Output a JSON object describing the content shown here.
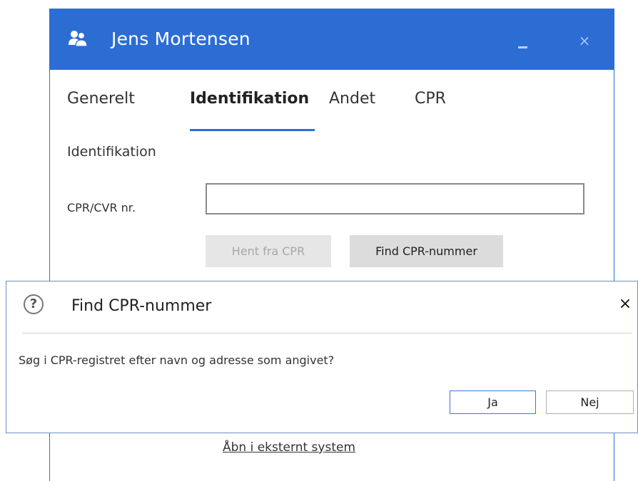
{
  "window": {
    "title": "Jens Mortensen",
    "icon": "people-icon",
    "close_glyph": "×"
  },
  "tabs": [
    {
      "label": "Generelt",
      "active": false
    },
    {
      "label": "Identifikation",
      "active": true
    },
    {
      "label": "Andet",
      "active": false
    },
    {
      "label": "CPR",
      "active": false
    }
  ],
  "form": {
    "section_title": "Identifikation",
    "cpr_label": "CPR/CVR nr.",
    "cpr_value": "",
    "hent_button": "Hent fra CPR",
    "find_button": "Find CPR-nummer",
    "external_link": "Åbn i eksternt system"
  },
  "dialog": {
    "title": "Find CPR-nummer",
    "message": "Søg i CPR-registret efter navn og adresse som angivet?",
    "yes_button": "Ja",
    "no_button": "Nej",
    "close_glyph": "×",
    "icon": "question-icon"
  },
  "colors": {
    "titlebar": "#2c6dd4",
    "accent": "#2c6dd4"
  }
}
